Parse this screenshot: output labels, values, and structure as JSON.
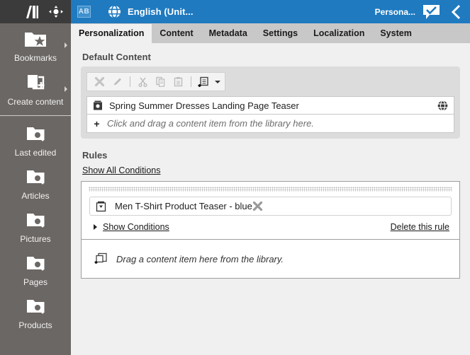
{
  "topbar": {
    "apps_icon": "grid-icon",
    "logo_icon": "books-logo-icon",
    "move_icon": "move-navigate-icon"
  },
  "header": {
    "ab_badge": "AB",
    "globe_icon": "globe-icon",
    "title": "English (Unit...",
    "persona_label": "Persona...",
    "comment_icon": "speech-bubble-check-icon",
    "back_icon": "chevron-left-icon",
    "accent_color": "#1f7ac0"
  },
  "sidebar": {
    "items": [
      {
        "label": "Bookmarks",
        "icon": "folder-star-icon",
        "has_arrow": true
      },
      {
        "label": "Create content",
        "icon": "page-plus-icon",
        "has_arrow": true
      },
      {
        "label": "Last edited",
        "icon": "folder-search-icon",
        "has_arrow": false
      },
      {
        "label": "Articles",
        "icon": "folder-search-icon",
        "has_arrow": false
      },
      {
        "label": "Pictures",
        "icon": "folder-search-icon",
        "has_arrow": false
      },
      {
        "label": "Pages",
        "icon": "folder-search-icon",
        "has_arrow": false
      },
      {
        "label": "Products",
        "icon": "folder-search-icon",
        "has_arrow": false
      }
    ],
    "background_color": "#6b6764"
  },
  "tabs": [
    {
      "label": "Personalization",
      "active": true
    },
    {
      "label": "Content",
      "active": false
    },
    {
      "label": "Metadata",
      "active": false
    },
    {
      "label": "Settings",
      "active": false
    },
    {
      "label": "Localization",
      "active": false
    },
    {
      "label": "System",
      "active": false
    }
  ],
  "default_content": {
    "title": "Default Content",
    "toolbar": [
      {
        "name": "remove-button",
        "icon": "x-remove-icon",
        "enabled": false
      },
      {
        "name": "edit-button",
        "icon": "pencil-icon",
        "enabled": false
      },
      {
        "name": "cut-button",
        "icon": "scissors-icon",
        "enabled": false
      },
      {
        "name": "copy-button",
        "icon": "copy-icon",
        "enabled": false
      },
      {
        "name": "paste-button",
        "icon": "paste-icon",
        "enabled": false
      },
      {
        "name": "add-new-button",
        "icon": "new-content-icon",
        "enabled": true
      }
    ],
    "item": {
      "icon": "teaser-content-icon",
      "label": "Spring Summer Dresses Landing Page Teaser",
      "right_icon": "globe-icon"
    },
    "placeholder": {
      "plus": "+",
      "text": "Click and drag a content item from the library here."
    }
  },
  "rules": {
    "title": "Rules",
    "show_all_conditions": "Show All Conditions",
    "rule": {
      "item_icon": "teaser-content-icon",
      "item_label": "Men T-Shirt Product Teaser - blue",
      "remove_icon": "x-remove-icon",
      "show_conditions": "Show Conditions",
      "delete_rule": "Delete this rule"
    },
    "dropzone": {
      "icon": "add-content-icon",
      "text": "Drag a content item here from the library."
    }
  }
}
